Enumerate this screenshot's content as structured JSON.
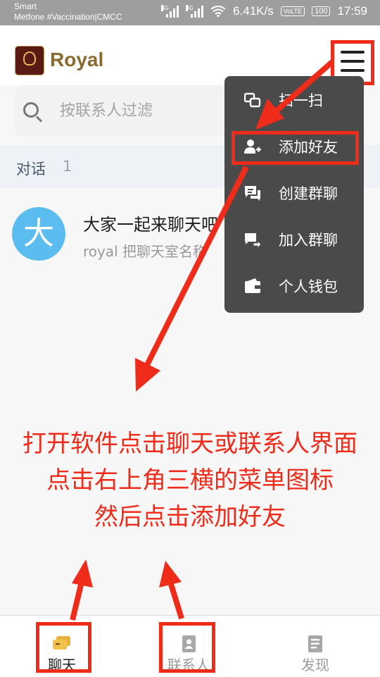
{
  "status_bar": {
    "carrier": "Smart",
    "network_label": "Metfone #Vaccination|CMCC",
    "net_4g": "4G",
    "net_3g": "3G",
    "speed": "6.41K/s",
    "volte": "VoLTE",
    "battery": "100",
    "time": "17:59"
  },
  "app": {
    "name": "Royal",
    "logo_icon": "royal-crest-logo"
  },
  "search": {
    "placeholder": "按联系人过滤",
    "value": ""
  },
  "section": {
    "title": "对话",
    "count": "1"
  },
  "conversation": {
    "avatar_letter": "大",
    "title": "大家一起来聊天吧",
    "preview": "royal 把聊天室名称"
  },
  "menu": {
    "items": [
      {
        "label": "扫一扫",
        "icon": "scan-icon"
      },
      {
        "label": "添加好友",
        "icon": "add-friend-icon"
      },
      {
        "label": "创建群聊",
        "icon": "create-group-icon"
      },
      {
        "label": "加入群聊",
        "icon": "join-group-icon"
      },
      {
        "label": "个人钱包",
        "icon": "wallet-icon"
      }
    ]
  },
  "instructions": {
    "line1": "打开软件点击聊天或联系人界面",
    "line2": "点击右上角三横的菜单图标",
    "line3": "然后点击添加好友"
  },
  "bottom_nav": {
    "items": [
      {
        "label": "聊天",
        "icon": "chat-icon"
      },
      {
        "label": "联系人",
        "icon": "contacts-icon"
      },
      {
        "label": "发现",
        "icon": "discover-icon"
      }
    ]
  },
  "colors": {
    "annotation_red": "#ef2b1a",
    "brand_gold": "#8b6a2f",
    "menu_bg": "#4a4a4a",
    "avatar_blue": "#5bbdef"
  }
}
